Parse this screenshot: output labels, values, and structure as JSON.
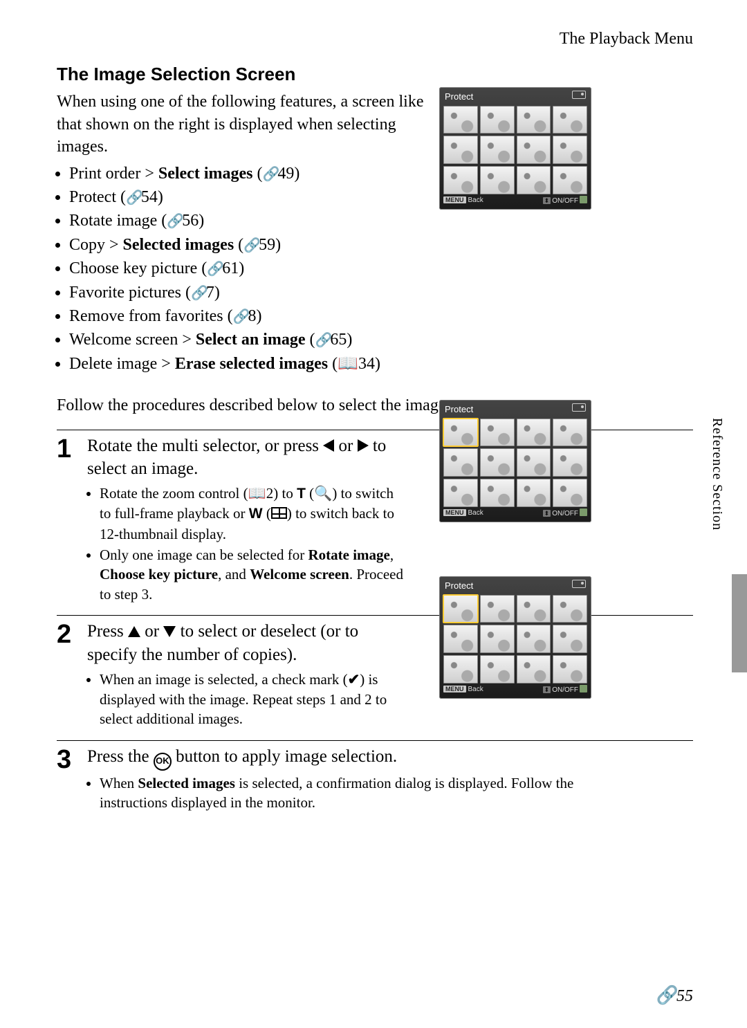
{
  "header": {
    "breadcrumb": "The Playback Menu"
  },
  "section": {
    "title": "The Image Selection Screen",
    "intro": "When using one of the following features, a screen like that shown on the right is displayed when selecting images."
  },
  "features": [
    {
      "prefix": "Print order > ",
      "bold": "Select images",
      "ref": "49"
    },
    {
      "prefix": "Protect",
      "bold": "",
      "ref": "54"
    },
    {
      "prefix": "Rotate image",
      "bold": "",
      "ref": "56"
    },
    {
      "prefix": "Copy > ",
      "bold": "Selected images",
      "ref": "59"
    },
    {
      "prefix": "Choose key picture",
      "bold": "",
      "ref": "61"
    },
    {
      "prefix": "Favorite pictures",
      "bold": "",
      "ref": "7"
    },
    {
      "prefix": "Remove from favorites",
      "bold": "",
      "ref": "8"
    },
    {
      "prefix": "Welcome screen > ",
      "bold": "Select an image",
      "ref": "65"
    },
    {
      "prefix": "Delete image > ",
      "bold": "Erase selected images",
      "ref_book": "34"
    }
  ],
  "follow": "Follow the procedures described below to select the images.",
  "steps": {
    "s1": {
      "num": "1",
      "head_a": "Rotate the multi selector, or press ",
      "head_b": " or ",
      "head_c": " to select an image.",
      "b1a": "Rotate the zoom control (",
      "b1b": "2) to ",
      "b1c": " (",
      "b1d": ") to switch to full-frame playback or ",
      "b1e": " (",
      "b1f": ") to switch back to 12-thumbnail display.",
      "b2a": "Only one image can be selected for ",
      "b2b": "Rotate image",
      "b2c": ", ",
      "b2d": "Choose key picture",
      "b2e": ", and ",
      "b2f": "Welcome screen",
      "b2g": ". Proceed to step 3."
    },
    "s2": {
      "num": "2",
      "head_a": "Press ",
      "head_b": " or ",
      "head_c": " to select or deselect (or to specify the number of copies).",
      "b1a": "When an image is selected, a check mark (",
      "b1b": ") is displayed with the image. Repeat steps 1 and 2 to select additional images."
    },
    "s3": {
      "num": "3",
      "head_a": "Press the ",
      "head_b": " button to apply image selection.",
      "b1a": "When ",
      "b1b": "Selected images",
      "b1c": " is selected, a confirmation dialog is displayed. Follow the instructions displayed in the monitor."
    }
  },
  "cam": {
    "title": "Protect",
    "back_tag": "MENU",
    "back_label": "Back",
    "onoff": "ON/OFF"
  },
  "side": {
    "label": "Reference Section"
  },
  "page": {
    "num": "55"
  },
  "glyph": {
    "T": "T",
    "W": "W",
    "OK": "OK",
    "magnify": "🔍",
    "book": "📖",
    "ref": "🔗",
    "check": "✔",
    "updown": "⬍"
  }
}
